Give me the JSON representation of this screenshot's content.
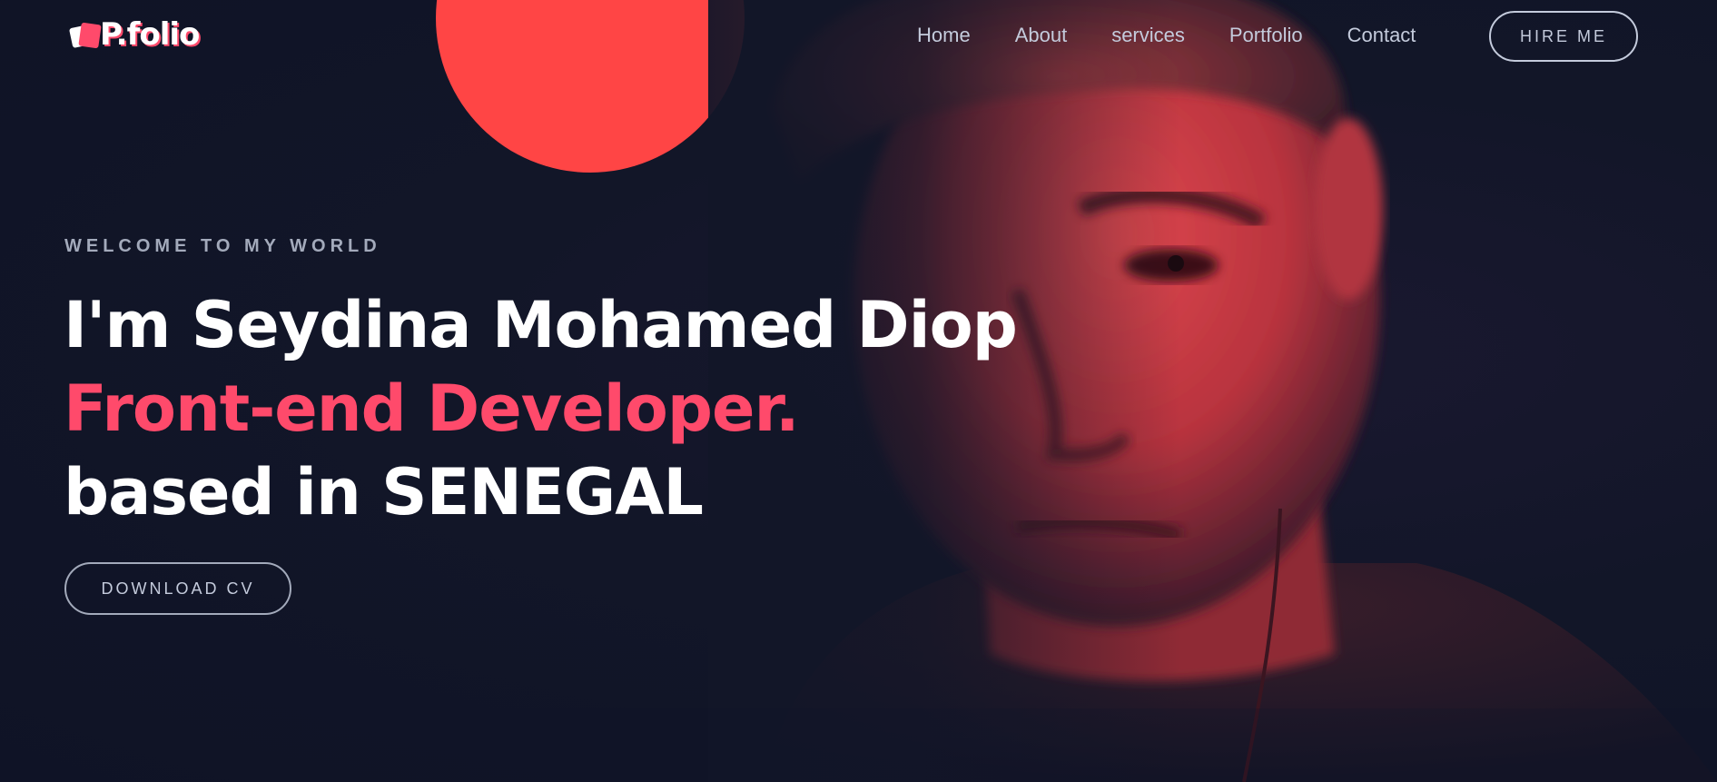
{
  "brand": {
    "logo_text": "P.folio",
    "logo_icon": "folio-cube-icon"
  },
  "nav": {
    "items": [
      {
        "label": "Home"
      },
      {
        "label": "About"
      },
      {
        "label": "services"
      },
      {
        "label": "Portfolio"
      },
      {
        "label": "Contact"
      }
    ],
    "hire_label": "HIRE ME"
  },
  "hero": {
    "tagline": "WELCOME TO MY WORLD",
    "greeting": "I'm Seydina Mohamed Diop",
    "role": "Front-end Developer.",
    "location": "based in SENEGAL",
    "cta_label": "DOWNLOAD CV",
    "image": "portrait-photo-red-tint"
  },
  "colors": {
    "background": "#101426",
    "accent": "#ff4a6b",
    "nav_text": "#c4cbdc",
    "muted_text": "#a3aabb",
    "photo_tint": "#ff4545"
  }
}
